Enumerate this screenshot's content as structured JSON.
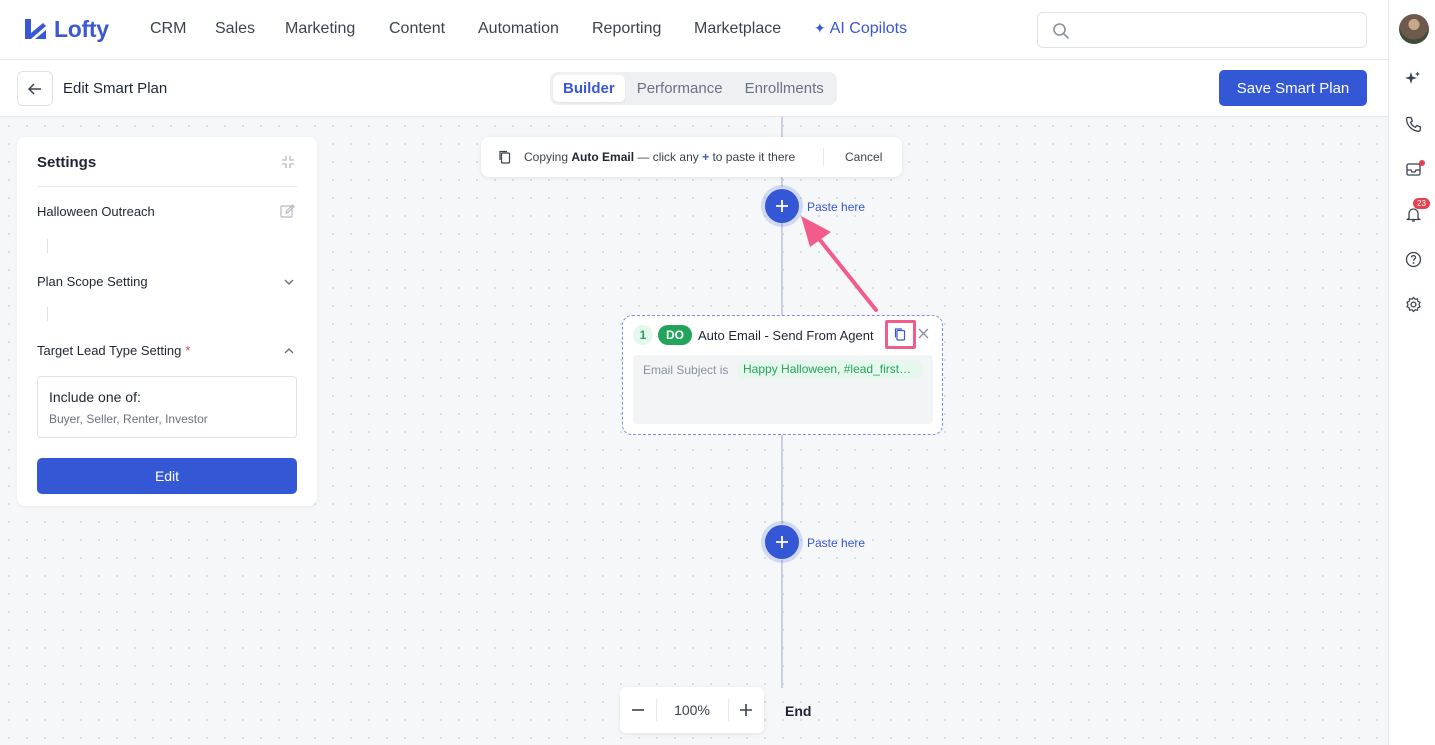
{
  "brand": {
    "name": "Lofty",
    "accent": "#3457d5"
  },
  "nav": {
    "items": [
      "CRM",
      "Sales",
      "Marketing",
      "Content",
      "Automation",
      "Reporting",
      "Marketplace"
    ],
    "ai_label": "AI Copilots"
  },
  "search": {
    "placeholder": ""
  },
  "rail": {
    "notification_count": "23"
  },
  "subheader": {
    "title": "Edit Smart Plan",
    "tabs": [
      "Builder",
      "Performance",
      "Enrollments"
    ],
    "active_tab": "Builder",
    "save_label": "Save Smart Plan"
  },
  "settings": {
    "title": "Settings",
    "plan_name": "Halloween Outreach",
    "scope_label": "Plan Scope Setting",
    "target_label": "Target Lead Type Setting",
    "required_mark": "*",
    "include_title": "Include one of:",
    "include_values": "Buyer, Seller, Renter, Investor",
    "edit_label": "Edit"
  },
  "toast": {
    "prefix": "Copying",
    "item": "Auto Email",
    "middle": "— click any",
    "plus": "+",
    "suffix": "to paste it there",
    "cancel_label": "Cancel"
  },
  "paste": {
    "label": "Paste here"
  },
  "node": {
    "step": "1",
    "type": "DO",
    "title": "Auto Email - Send From Agent",
    "subject_label": "Email Subject is",
    "subject_value": "Happy Halloween, #lead_first_name#"
  },
  "zoom": {
    "value": "100%"
  },
  "end": {
    "label": "End"
  }
}
